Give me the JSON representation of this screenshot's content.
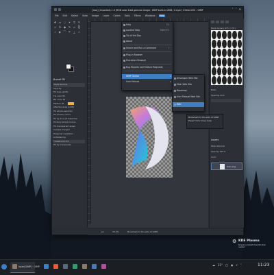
{
  "window": {
    "title": "[Icon] (imported)-1.0 (RGB color 8-bit gamma integer, GIMP built-in sRGB, 1 layer) 1344x1200 – GIMP",
    "controls": [
      "˅",
      "˄",
      "✕"
    ]
  },
  "menubar": [
    "File",
    "Edit",
    "Select",
    "View",
    "Image",
    "Layer",
    "Colors",
    "Tools",
    "Filters",
    "Windows",
    "Help"
  ],
  "help_menu": {
    "items": [
      {
        "label": "Help",
        "shortcut": "F1"
      },
      {
        "label": "Context Help",
        "shortcut": "Shift+F1"
      },
      {
        "label": "Tip of the Day",
        "shortcut": ""
      },
      {
        "label": "About",
        "shortcut": ""
      },
      {
        "label": "Search and Run a Command",
        "shortcut": "/"
      },
      {
        "label": "Plug-in Browser",
        "shortcut": ""
      },
      {
        "label": "Procedure Browser",
        "shortcut": ""
      },
      {
        "label": "Bug Reports and Feature Requests",
        "shortcut": ""
      },
      {
        "label": "GIMP Online",
        "shortcut": ""
      },
      {
        "label": "User Manual",
        "shortcut": ""
      }
    ]
  },
  "submenu": {
    "items": [
      "Developer Web Site",
      "Main Web Site",
      "Roadmap",
      "User Manual Web Site",
      "Wiki"
    ]
  },
  "tooltip": {
    "line1": "Bookmark to the wiki of GIMP",
    "line2": "Press F1 for more help"
  },
  "tool_options": {
    "title": "Bucket Fill",
    "rows": [
      "Opacity",
      "Fill type (shift)",
      "FG color fill",
      "BG color fill",
      "Pattern fill",
      "Affected area (shift)",
      "Fill whole selection",
      "Fill similar colors",
      "Fill by line art detection",
      "Finding Similar Colors",
      "Fill transparent areas",
      "Sample merged",
      "Diagonal neighbors",
      "Antialiasing",
      "Threshold",
      "Fill by"
    ],
    "mode_label": "Mode",
    "mode_value": "Normal",
    "threshold_value": "15.0",
    "fill_by_value": "Composite"
  },
  "right_dock": {
    "brush_label": "Pixels Generic 2(51 × 51)",
    "brush_mode_label": "Basic",
    "spacing_label": "Spacing",
    "spacing_value": "10.0",
    "layers_title": "Layers",
    "layer_mode": "Mode",
    "layer_mode_value": "Normal",
    "opacity_label": "Opacity",
    "opacity_value": "100.0",
    "lock_label": "Lock:",
    "layer_name": "Icon png"
  },
  "statusbar": {
    "unit": "px",
    "zoom": "33.3%",
    "message": "Bookmark to the wiki of GIMP"
  },
  "kde": {
    "name": "KDE Plasma",
    "subtitle": "Simple by default, Powerful when needed."
  },
  "taskbar": {
    "task_label": "layer(GIMP) · GIMP",
    "weather": "11°",
    "time": "11:23"
  },
  "colors": {
    "accent": "#3d7fc2",
    "window_bg": "#2a2d33",
    "foreground": "#f2f2f2",
    "background_color": "#111111"
  }
}
